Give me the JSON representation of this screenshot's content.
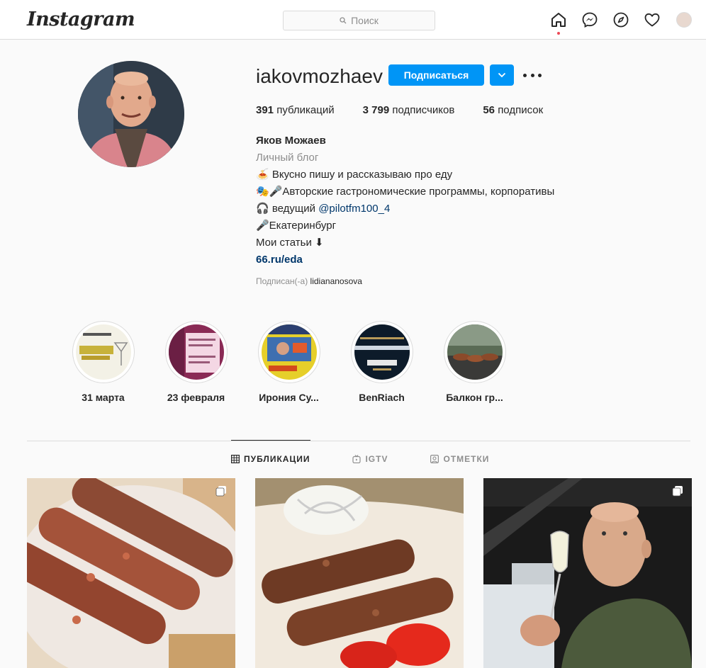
{
  "header": {
    "logo": "Instagram",
    "search_placeholder": "Поиск",
    "icons": [
      "home-icon",
      "messenger-icon",
      "explore-icon",
      "heart-icon",
      "profile-avatar"
    ]
  },
  "profile": {
    "username": "iakovmozhaev",
    "follow_label": "Подписаться",
    "stats": {
      "posts": "391",
      "posts_label": "публикаций",
      "followers": "3 799",
      "followers_label": "подписчиков",
      "following": "56",
      "following_label": "подписок"
    },
    "bio": {
      "name": "Яков Можаев",
      "category": "Личный блог",
      "line1": "🍝 Вкусно пишу и рассказываю про еду",
      "line2": "🎭🎤Авторские гастрономические программы, корпоративы",
      "line3_prefix": "🎧 ведущий ",
      "line3_link": "@pilotfm100_4",
      "line4": "🎤Екатеринбург",
      "line5": "Мои статьи ⬇",
      "site": "66.ru/eda"
    },
    "followed_by_label": "Подписан(-а)",
    "followed_by_user": "lidiananosova"
  },
  "highlights": [
    {
      "label": "31 марта"
    },
    {
      "label": "23 февраля"
    },
    {
      "label": "Ирония Су..."
    },
    {
      "label": "BenRiach"
    },
    {
      "label": "Балкон гр..."
    }
  ],
  "tabs": [
    {
      "label": "ПУБЛИКАЦИИ",
      "active": true
    },
    {
      "label": "IGTV",
      "active": false
    },
    {
      "label": "ОТМЕТКИ",
      "active": false
    }
  ],
  "colors": {
    "accent": "#0095f6",
    "link": "#00376b",
    "muted": "#8e8e8e",
    "notification": "#ed4956"
  }
}
